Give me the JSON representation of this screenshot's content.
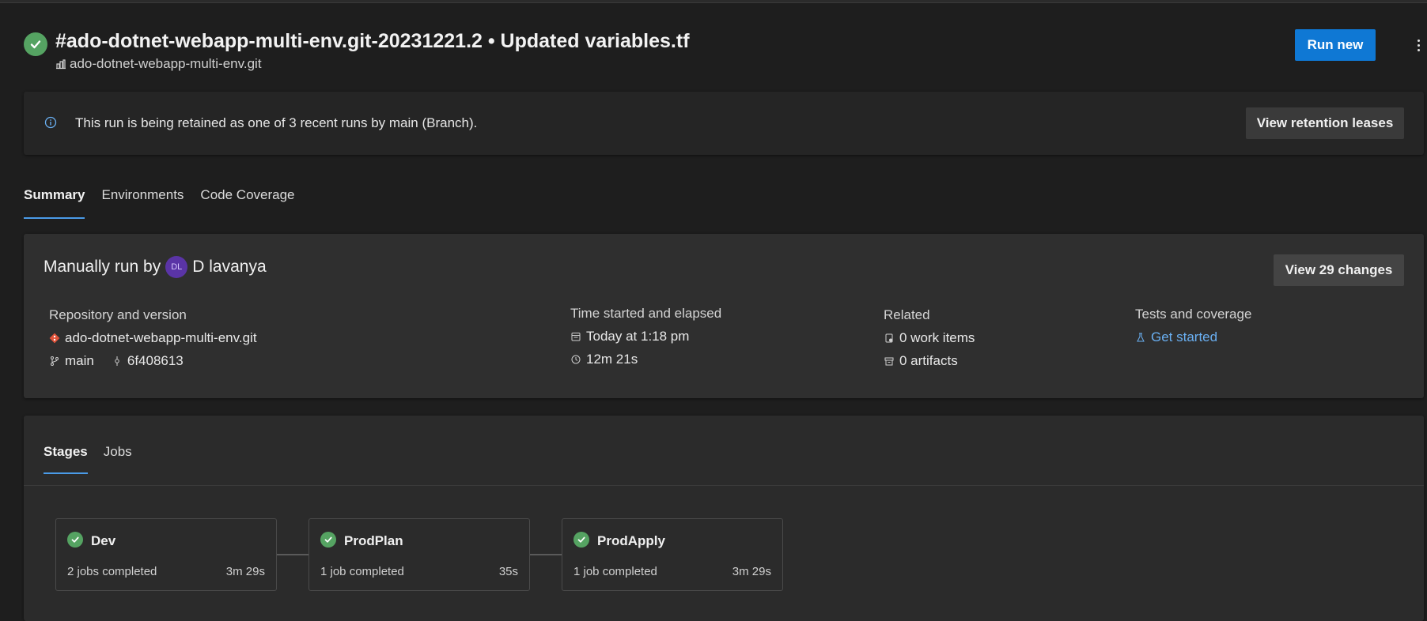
{
  "run": {
    "title": "#ado-dotnet-webapp-multi-env.git-20231221.2 • Updated variables.tf",
    "repo": "ado-dotnet-webapp-multi-env.git",
    "run_new_label": "Run new"
  },
  "banner": {
    "text": "This run is being retained as one of 3 recent runs by main (Branch).",
    "button_label": "View retention leases"
  },
  "tabs": [
    "Summary",
    "Environments",
    "Code Coverage"
  ],
  "summary": {
    "manual_prefix": "Manually run by",
    "avatar_initials": "DL",
    "user": "D lavanya",
    "view_changes_label": "View 29 changes",
    "repo_label": "Repository and version",
    "repo_name": "ado-dotnet-webapp-multi-env.git",
    "branch": "main",
    "commit": "6f408613",
    "time_label": "Time started and elapsed",
    "started": "Today at 1:18 pm",
    "elapsed": "12m 21s",
    "related_label": "Related",
    "work_items": "0 work items",
    "artifacts": "0 artifacts",
    "tests_label": "Tests and coverage",
    "get_started": "Get started"
  },
  "stage_tabs": [
    "Stages",
    "Jobs"
  ],
  "stages": [
    {
      "name": "Dev",
      "jobs": "2 jobs completed",
      "time": "3m 29s"
    },
    {
      "name": "ProdPlan",
      "jobs": "1 job completed",
      "time": "35s"
    },
    {
      "name": "ProdApply",
      "jobs": "1 job completed",
      "time": "3m 29s"
    }
  ],
  "colors": {
    "success": "#55a362",
    "primary": "#0f78d4",
    "link": "#6ab0f3",
    "avatar": "#5a34a6"
  }
}
